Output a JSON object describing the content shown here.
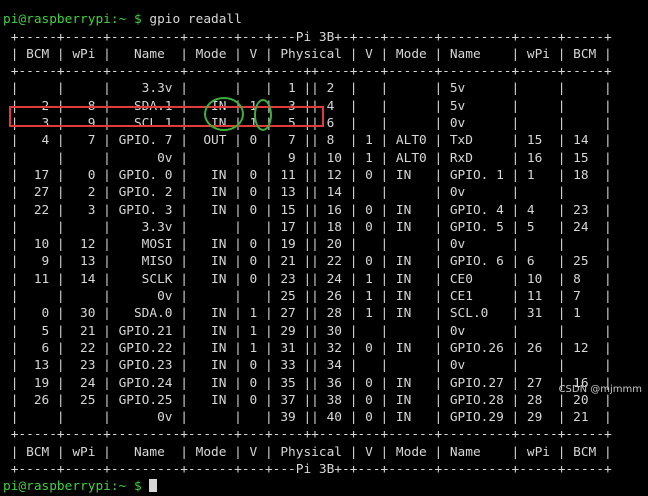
{
  "terminal": {
    "partial_top": "                                                                                ",
    "prompt": "pi@raspberrypi:~ $",
    "command": " gpio readall",
    "separator_top": " +-----+-----+---------+------+---+---Pi 3B+-+---+------+---------+-----+-----+",
    "header": " | BCM | wPi |   Name  | Mode | V | Physical | V | Mode | Name    | wPi | BCM |",
    "separator_mid": " +-----+-----+---------+------+---+----++----+---+------+---------+-----+-----+",
    "rows": [
      " |     |     |    3.3v |      |   |  1 || 2  |   |      | 5v      |     |     |",
      " |   2 |   8 |   SDA.1 |   IN | 1 |  3 || 4  |   |      | 5v      |     |     |",
      " |   3 |   9 |   SCL.1 |   IN | 1 |  5 || 6  |   |      | 0v      |     |     |",
      " |   4 |   7 | GPIO. 7 |  OUT | 0 |  7 || 8  | 1 | ALT0 | TxD     | 15  | 14  |",
      " |     |     |      0v |      |   |  9 || 10 | 1 | ALT0 | RxD     | 16  | 15  |",
      " |  17 |   0 | GPIO. 0 |   IN | 0 | 11 || 12 | 0 | IN   | GPIO. 1 | 1   | 18  |",
      " |  27 |   2 | GPIO. 2 |   IN | 0 | 13 || 14 |   |      | 0v      |     |     |",
      " |  22 |   3 | GPIO. 3 |   IN | 0 | 15 || 16 | 0 | IN   | GPIO. 4 | 4   | 23  |",
      " |     |     |    3.3v |      |   | 17 || 18 | 0 | IN   | GPIO. 5 | 5   | 24  |",
      " |  10 |  12 |    MOSI |   IN | 0 | 19 || 20 |   |      | 0v      |     |     |",
      " |   9 |  13 |    MISO |   IN | 0 | 21 || 22 | 0 | IN   | GPIO. 6 | 6   | 25  |",
      " |  11 |  14 |    SCLK |   IN | 0 | 23 || 24 | 1 | IN   | CE0     | 10  | 8   |",
      " |     |     |      0v |      |   | 25 || 26 | 1 | IN   | CE1     | 11  | 7   |",
      " |   0 |  30 |   SDA.0 |   IN | 1 | 27 || 28 | 1 | IN   | SCL.0   | 31  | 1   |",
      " |   5 |  21 | GPIO.21 |   IN | 1 | 29 || 30 |   |      | 0v      |     |     |",
      " |   6 |  22 | GPIO.22 |   IN | 1 | 31 || 32 | 0 | IN   | GPIO.26 | 26  | 12  |",
      " |  13 |  23 | GPIO.23 |   IN | 0 | 33 || 34 |   |      | 0v      |     |     |",
      " |  19 |  24 | GPIO.24 |   IN | 0 | 35 || 36 | 0 | IN   | GPIO.27 | 27  | 16  |",
      " |  26 |  25 | GPIO.25 |   IN | 0 | 37 || 38 | 0 | IN   | GPIO.28 | 28  | 20  |",
      " |     |     |      0v |      |   | 39 || 40 | 0 | IN   | GPIO.29 | 29  | 21  |"
    ],
    "footer": " | BCM | wPi |   Name  | Mode | V | Physical | V | Mode | Name    | wPi | BCM |",
    "separator_bottom": " +-----+-----+---------+------+---+---Pi 3B+-+---+------+---------+-----+-----+",
    "prompt_bottom": "pi@raspberrypi:~ $ "
  },
  "watermark": "CSDN @mjmmm",
  "colors": {
    "prompt": "#3fd23f",
    "text": "#d7d7d7",
    "highlight_rect": "#e03a3a",
    "highlight_oval": "#3fae3f"
  }
}
